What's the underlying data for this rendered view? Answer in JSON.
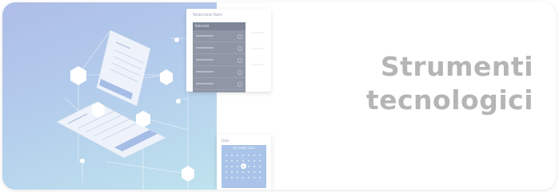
{
  "card": {
    "title_line1": "Strumenti",
    "title_line2": "tecnologici",
    "title_color": "#b5b5b5"
  },
  "illustration": {
    "background_gradient": [
      "#aebde7",
      "#b3ccec",
      "#bfe3ee"
    ],
    "panel_top": {
      "title": "Selecione Item",
      "dropdown_header": "Selected"
    },
    "panel_bottom": {
      "label": "Date",
      "month": "OCTOBER 2020"
    }
  }
}
